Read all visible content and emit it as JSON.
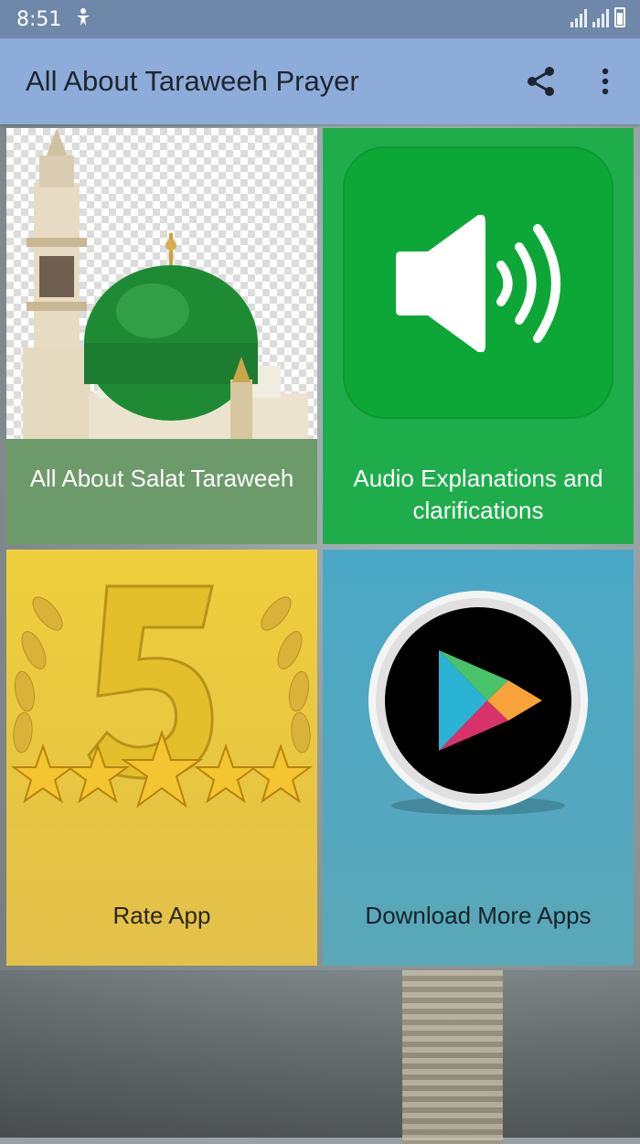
{
  "status_bar": {
    "time": "8:51",
    "notification_icon": "accessibility-icon",
    "signal_icons": [
      "signal-icon",
      "signal-icon"
    ],
    "battery_icon": "battery-charging-icon"
  },
  "app_bar": {
    "title": "All About Taraweeh Prayer",
    "share_icon": "share-icon",
    "more_icon": "more-vert-icon",
    "color": "#8eacd9"
  },
  "tiles": [
    {
      "label": "All About Salat Taraweeh",
      "image": "mosque-dome-image",
      "color": "#6d9a6b"
    },
    {
      "label": "Audio Explanations and clarifications",
      "image": "speaker-icon",
      "color": "#1fad4c"
    },
    {
      "label": "Rate App",
      "image": "five-stars-laurel-image",
      "color": "#e3c23a"
    },
    {
      "label": "Download More Apps",
      "image": "play-store-icon",
      "color": "#49a6c3"
    }
  ]
}
